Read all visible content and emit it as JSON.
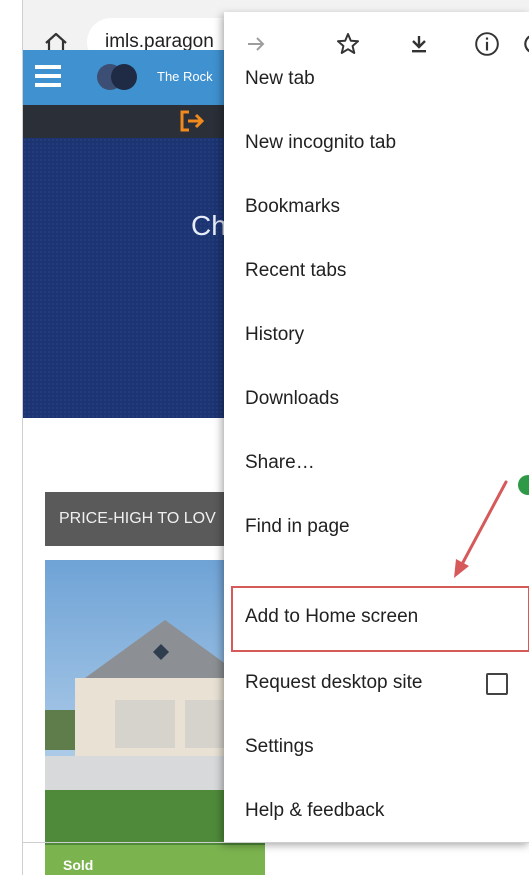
{
  "browser": {
    "url": "imls.paragon",
    "icons": {
      "home": "home-icon",
      "forward": "forward-arrow-icon",
      "bookmark": "star-icon",
      "download": "download-icon",
      "info": "info-icon",
      "reload": "reload-icon"
    }
  },
  "site": {
    "name": "The Rock",
    "hero_text": "Ch",
    "sort_label": "PRICE-HIGH TO LOV",
    "photo_tag": "Sold"
  },
  "menu": {
    "items": [
      {
        "label": "New tab"
      },
      {
        "label": "New incognito tab"
      },
      {
        "label": "Bookmarks"
      },
      {
        "label": "Recent tabs"
      },
      {
        "label": "History"
      },
      {
        "label": "Downloads"
      },
      {
        "label": "Share…"
      },
      {
        "label": "Find in page"
      },
      {
        "label": "Add to Home screen"
      },
      {
        "label": "Request desktop site"
      },
      {
        "label": "Settings"
      },
      {
        "label": "Help & feedback"
      }
    ],
    "highlighted_item": "Add to Home screen",
    "request_desktop_checked": false
  },
  "colors": {
    "toolbar_bg": "#f2f2f2",
    "site_header_bg": "#3f91d0",
    "hero_bg": "#1c3472",
    "annotation_red": "#d55a59",
    "login_icon_orange": "#f08a1c"
  }
}
